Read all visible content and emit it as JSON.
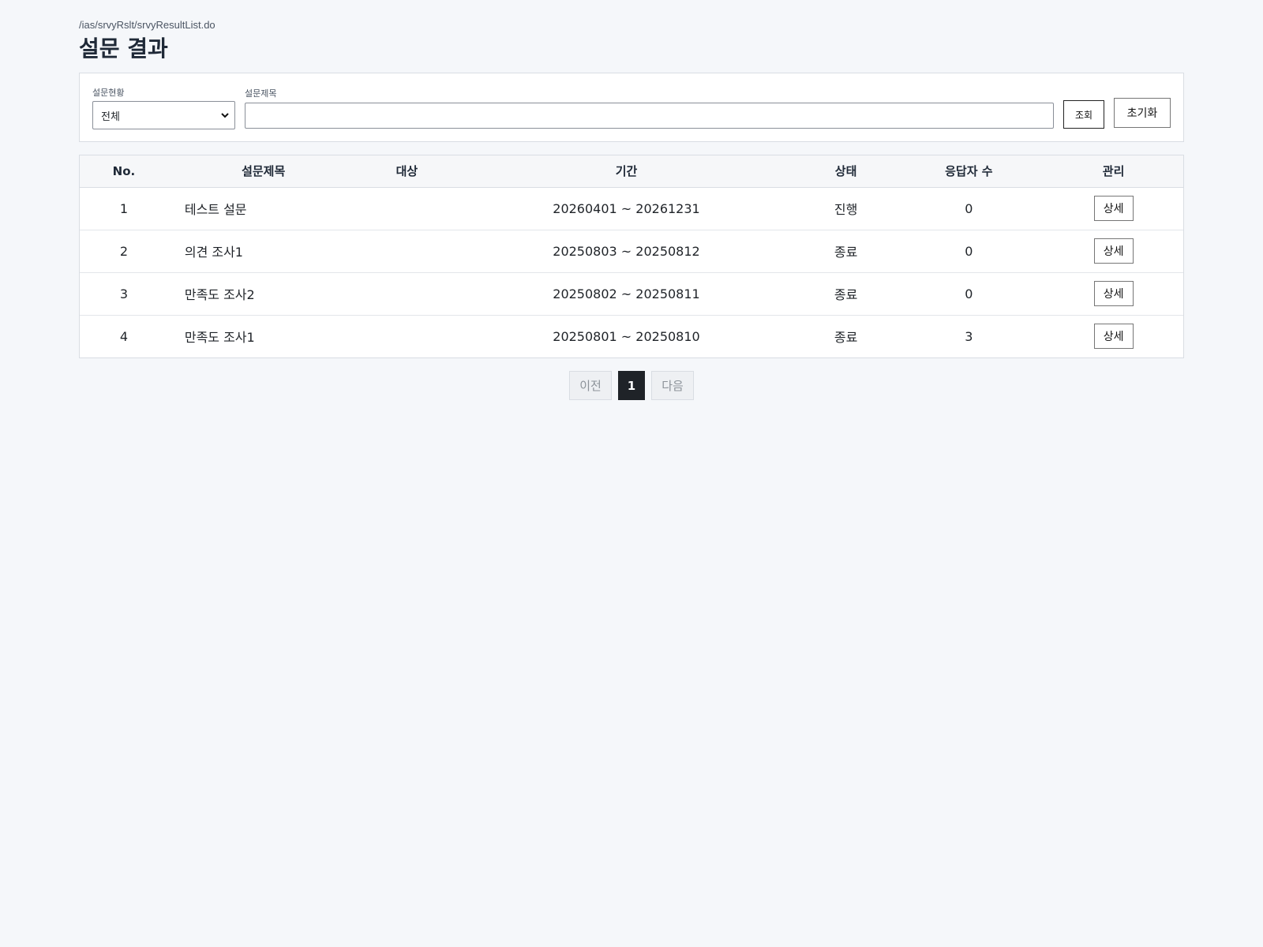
{
  "header": {
    "path": "/ias/srvyRslt/srvyResultList.do",
    "title": "설문 결과"
  },
  "search": {
    "status_label": "설문현황",
    "status_value": "전체",
    "title_label": "설문제목",
    "title_value": "",
    "search_button": "조회",
    "reset_button": "초기화"
  },
  "table": {
    "headers": {
      "no": "No.",
      "title": "설문제목",
      "target": "대상",
      "period": "기간",
      "status": "상태",
      "respondents": "응답자 수",
      "manage": "관리"
    },
    "rows": [
      {
        "no": "1",
        "title": "테스트 설문",
        "target": "",
        "period": "20260401 ~ 20261231",
        "status": "진행",
        "respondents": "0",
        "action": "상세"
      },
      {
        "no": "2",
        "title": "의견 조사1",
        "target": "",
        "period": "20250803 ~ 20250812",
        "status": "종료",
        "respondents": "0",
        "action": "상세"
      },
      {
        "no": "3",
        "title": "만족도 조사2",
        "target": "",
        "period": "20250802 ~ 20250811",
        "status": "종료",
        "respondents": "0",
        "action": "상세"
      },
      {
        "no": "4",
        "title": "만족도 조사1",
        "target": "",
        "period": "20250801 ~ 20250810",
        "status": "종료",
        "respondents": "3",
        "action": "상세"
      }
    ]
  },
  "pagination": {
    "prev": "이전",
    "current": "1",
    "next": "다음"
  },
  "icons": {
    "status_dropdown": "chevron-down-icon"
  }
}
